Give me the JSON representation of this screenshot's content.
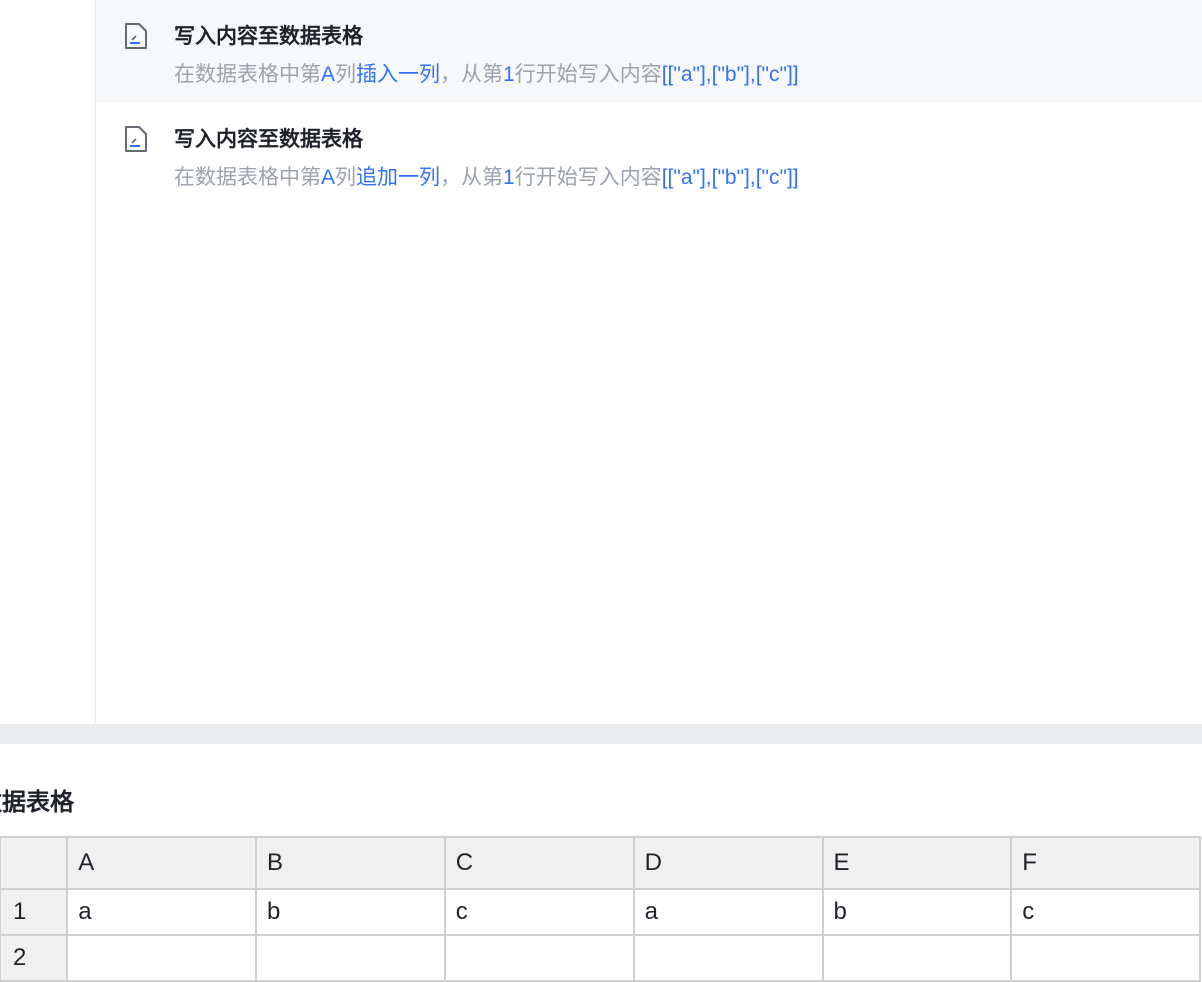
{
  "items": [
    {
      "title": "写入内容至数据表格",
      "desc": {
        "p1": "在数据表格中第",
        "col": "A",
        "p2": "列",
        "action": "插入一列",
        "p3": "，从第",
        "row": "1",
        "p4": "行开始写入内容",
        "content": "[[\"a\"],[\"b\"],[\"c\"]]"
      }
    },
    {
      "title": "写入内容至数据表格",
      "desc": {
        "p1": "在数据表格中第",
        "col": "A",
        "p2": "列",
        "action": "追加一列",
        "p3": "，从第",
        "row": "1",
        "p4": "行开始写入内容",
        "content": "[[\"a\"],[\"b\"],[\"c\"]]"
      }
    }
  ],
  "sheet": {
    "title": "数据表格",
    "columns": [
      "A",
      "B",
      "C",
      "D",
      "E",
      "F"
    ],
    "rows": [
      {
        "num": "1",
        "cells": [
          "a",
          "b",
          "c",
          "a",
          "b",
          "c"
        ]
      },
      {
        "num": "2",
        "cells": [
          "",
          "",
          "",
          "",
          "",
          ""
        ]
      }
    ]
  }
}
